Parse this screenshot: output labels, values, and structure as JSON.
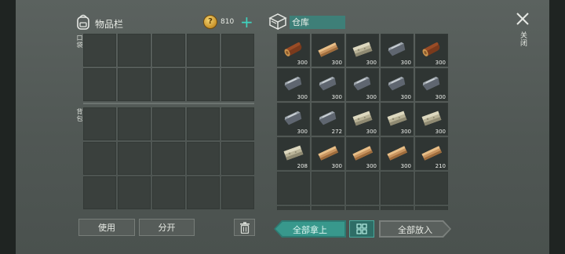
{
  "inventory": {
    "title": "物品栏",
    "icon": "backpack-icon",
    "coins": "810",
    "add_label": "+",
    "quick_label": "口袋",
    "bag_label": "背包"
  },
  "buttons": {
    "use": "使用",
    "split": "分开",
    "trash": "trash-icon"
  },
  "warehouse": {
    "title": "仓库",
    "icon": "crate-icon",
    "take_all": "全部拿上",
    "put_all": "全部放入",
    "sort_icon": "sort-grid-icon",
    "items": [
      {
        "type": "log",
        "count": "300"
      },
      {
        "type": "plank",
        "count": "300"
      },
      {
        "type": "stone",
        "count": "300"
      },
      {
        "type": "iron",
        "count": "300"
      },
      {
        "type": "log",
        "count": "300"
      },
      {
        "type": "iron",
        "count": "300"
      },
      {
        "type": "iron",
        "count": "300"
      },
      {
        "type": "iron",
        "count": "300"
      },
      {
        "type": "iron",
        "count": "300"
      },
      {
        "type": "iron",
        "count": "300"
      },
      {
        "type": "iron",
        "count": "300"
      },
      {
        "type": "iron",
        "count": "272"
      },
      {
        "type": "stone",
        "count": "300"
      },
      {
        "type": "stone",
        "count": "300"
      },
      {
        "type": "stone",
        "count": "300"
      },
      {
        "type": "stone",
        "count": "208"
      },
      {
        "type": "plank",
        "count": "300"
      },
      {
        "type": "plank",
        "count": "300"
      },
      {
        "type": "plank",
        "count": "300"
      },
      {
        "type": "plank",
        "count": "210"
      }
    ]
  },
  "close": {
    "label": "关闭",
    "icon": "close-icon"
  },
  "colors": {
    "accent": "#38988c",
    "slot": "#3a403d",
    "background": "#555c59"
  }
}
